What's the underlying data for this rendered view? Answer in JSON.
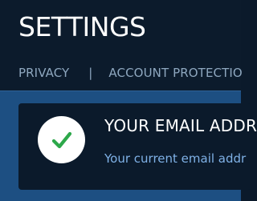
{
  "header": {
    "title": "SETTINGS"
  },
  "nav": {
    "tabs": [
      {
        "label": "PRIVACY"
      },
      {
        "label": "ACCOUNT PROTECTIO"
      }
    ],
    "separator": "|"
  },
  "email_card": {
    "icon": "check-icon",
    "title": "YOUR EMAIL ADDR",
    "description": "Your current email addr"
  },
  "colors": {
    "header_bg": "#0c1b2c",
    "content_bg": "#1d4f82",
    "card_bg": "#0b1a2b",
    "title_text": "#ffffff",
    "nav_text": "#8ea7bf",
    "link_text": "#7fb1e6",
    "check_green": "#2da84a"
  }
}
